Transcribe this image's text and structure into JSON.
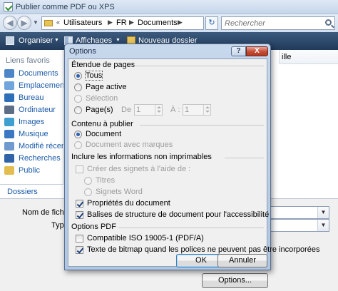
{
  "window": {
    "title": "Publier comme PDF ou XPS"
  },
  "address_bar": {
    "crumbs": [
      "Utilisateurs",
      "FR",
      "Documents"
    ],
    "search_placeholder": "Rechercher"
  },
  "toolbar": {
    "organize": "Organiser",
    "views": "Affichages",
    "new_folder": "Nouveau dossier"
  },
  "nav_pane": {
    "header": "Liens favoris",
    "items": [
      {
        "label": "Documents",
        "icon": "documents-icon"
      },
      {
        "label": "Emplacements",
        "icon": "places-icon"
      },
      {
        "label": "Bureau",
        "icon": "desktop-icon"
      },
      {
        "label": "Ordinateur",
        "icon": "computer-icon"
      },
      {
        "label": "Images",
        "icon": "pictures-icon"
      },
      {
        "label": "Musique",
        "icon": "music-icon"
      },
      {
        "label": "Modifié récemm",
        "icon": "recent-icon"
      },
      {
        "label": "Recherches",
        "icon": "searches-icon"
      },
      {
        "label": "Public",
        "icon": "public-folder-icon"
      }
    ],
    "folders_toggle": "Dossiers"
  },
  "content": {
    "column_header_partial": "ille"
  },
  "bottom": {
    "filename_label": "Nom de fichier",
    "type_label": "Type",
    "options_button": "Options..."
  },
  "dialog": {
    "title": "Options",
    "help": "?",
    "close": "X",
    "page_range": {
      "title": "Étendue de pages",
      "all": "Tous",
      "current_page": "Page active",
      "selection": "Sélection",
      "pages": "Page(s)",
      "from_label": "De :",
      "from_value": "1",
      "to_label": "À :",
      "to_value": "1"
    },
    "publish_what": {
      "title": "Contenu à publier",
      "document": "Document",
      "document_markup": "Document avec marques"
    },
    "non_printing": {
      "title": "Inclure les informations non imprimables",
      "create_bookmarks": "Créer des signets à l'aide de :",
      "headings": "Titres",
      "word_bookmarks": "Signets Word",
      "doc_properties": "Propriétés du document",
      "structure_tags": "Balises de structure de document pour l'accessibilité"
    },
    "pdf_options": {
      "title": "Options PDF",
      "iso_compliant": "Compatible ISO 19005-1 (PDF/A)",
      "bitmap_text": "Texte de bitmap quand les polices ne peuvent pas être incorporées"
    },
    "buttons": {
      "ok": "OK",
      "cancel": "Annuler"
    },
    "state": {
      "all_selected": true,
      "document_selected": true,
      "doc_properties_checked": true,
      "structure_tags_checked": true,
      "iso_checked": false,
      "bitmap_text_checked": true
    }
  },
  "colors": {
    "toolbar_bg": "#203a5b",
    "link_blue": "#1a5aa8",
    "dialog_frame": "#b0c6e1",
    "close_red": "#c44a33"
  }
}
